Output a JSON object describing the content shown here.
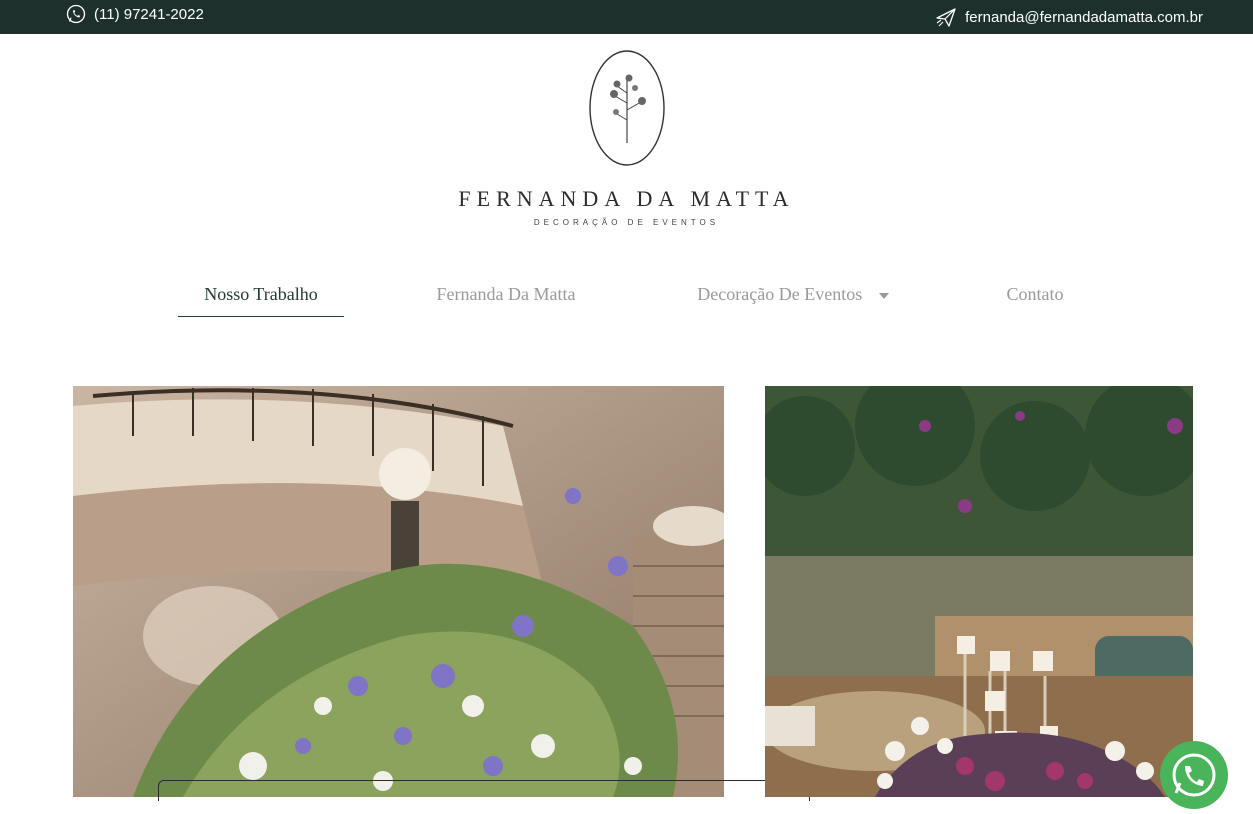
{
  "topbar": {
    "phone": "(11) 97241-2022",
    "email": "fernanda@fernandadamatta.com.br",
    "phone_icon": "whatsapp-icon",
    "email_icon": "paper-plane-icon",
    "background": "#1d302c"
  },
  "logo": {
    "name": "FERNANDA DA MATTA",
    "tagline": "DECORAÇÃO DE EVENTOS"
  },
  "nav": {
    "items": [
      {
        "label": "Nosso Trabalho",
        "active": true
      },
      {
        "label": "Fernanda Da Matta",
        "active": false
      },
      {
        "label": "Decoração De Eventos",
        "active": false,
        "has_dropdown": true
      },
      {
        "label": "Contato",
        "active": false
      }
    ]
  },
  "gallery": {
    "items": [
      {
        "subject": "staircase floral arrangement"
      },
      {
        "subject": "garden event with candles and tulips"
      }
    ]
  },
  "floating": {
    "whatsapp_color": "#49b45a",
    "icon": "whatsapp-icon"
  }
}
